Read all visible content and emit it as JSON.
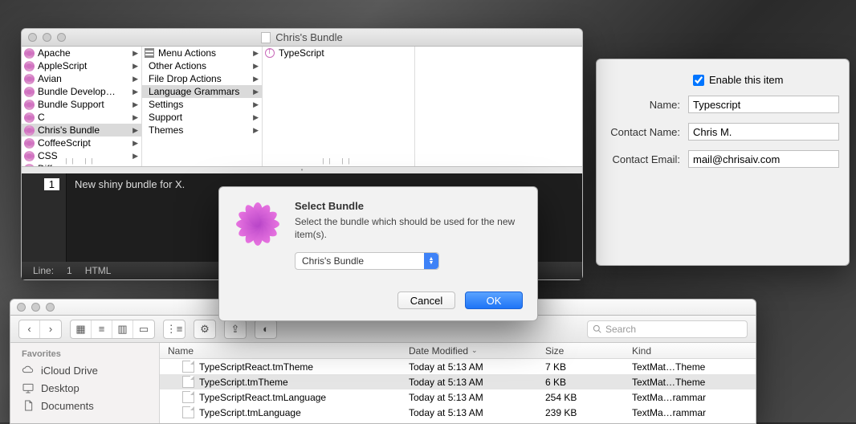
{
  "bundle_window": {
    "title": "Chris's Bundle",
    "col1": [
      "Apache",
      "AppleScript",
      "Avian",
      "Bundle Develop…",
      "Bundle Support",
      "C",
      "Chris's Bundle",
      "CoffeeScript",
      "CSS",
      "Diff"
    ],
    "col1_selected_index": 6,
    "col2": [
      "Menu Actions",
      "Other Actions",
      "File Drop Actions",
      "Language Grammars",
      "Settings",
      "Support",
      "Themes"
    ],
    "col2_selected_index": 3,
    "col3": [
      "TypeScript"
    ],
    "editor_line_no": "1",
    "editor_text": "New shiny bundle for X.",
    "status_line_label": "Line:",
    "status_line_value": "1",
    "status_lang": "HTML"
  },
  "props": {
    "enable_label": "Enable this item",
    "enable_checked": true,
    "name_label": "Name:",
    "name_value": "Typescript",
    "contact_name_label": "Contact Name:",
    "contact_name_value": "Chris M.",
    "contact_email_label": "Contact Email:",
    "contact_email_value": "mail@chrisaiv.com"
  },
  "dialog": {
    "title": "Select Bundle",
    "message": "Select the bundle which should be used for the new item(s).",
    "selected": "Chris's Bundle",
    "cancel": "Cancel",
    "ok": "OK"
  },
  "finder": {
    "sidebar_heading": "Favorites",
    "sidebar_items": [
      "iCloud Drive",
      "Desktop",
      "Documents"
    ],
    "search_placeholder": "Search",
    "columns": {
      "name": "Name",
      "date": "Date Modified",
      "size": "Size",
      "kind": "Kind"
    },
    "rows": [
      {
        "name": "TypeScriptReact.tmTheme",
        "date": "Today at 5:13 AM",
        "size": "7 KB",
        "kind": "TextMat…Theme"
      },
      {
        "name": "TypeScript.tmTheme",
        "date": "Today at 5:13 AM",
        "size": "6 KB",
        "kind": "TextMat…Theme"
      },
      {
        "name": "TypeScriptReact.tmLanguage",
        "date": "Today at 5:13 AM",
        "size": "254 KB",
        "kind": "TextMa…rammar"
      },
      {
        "name": "TypeScript.tmLanguage",
        "date": "Today at 5:13 AM",
        "size": "239 KB",
        "kind": "TextMa…rammar"
      }
    ],
    "selected_row_index": 1
  }
}
